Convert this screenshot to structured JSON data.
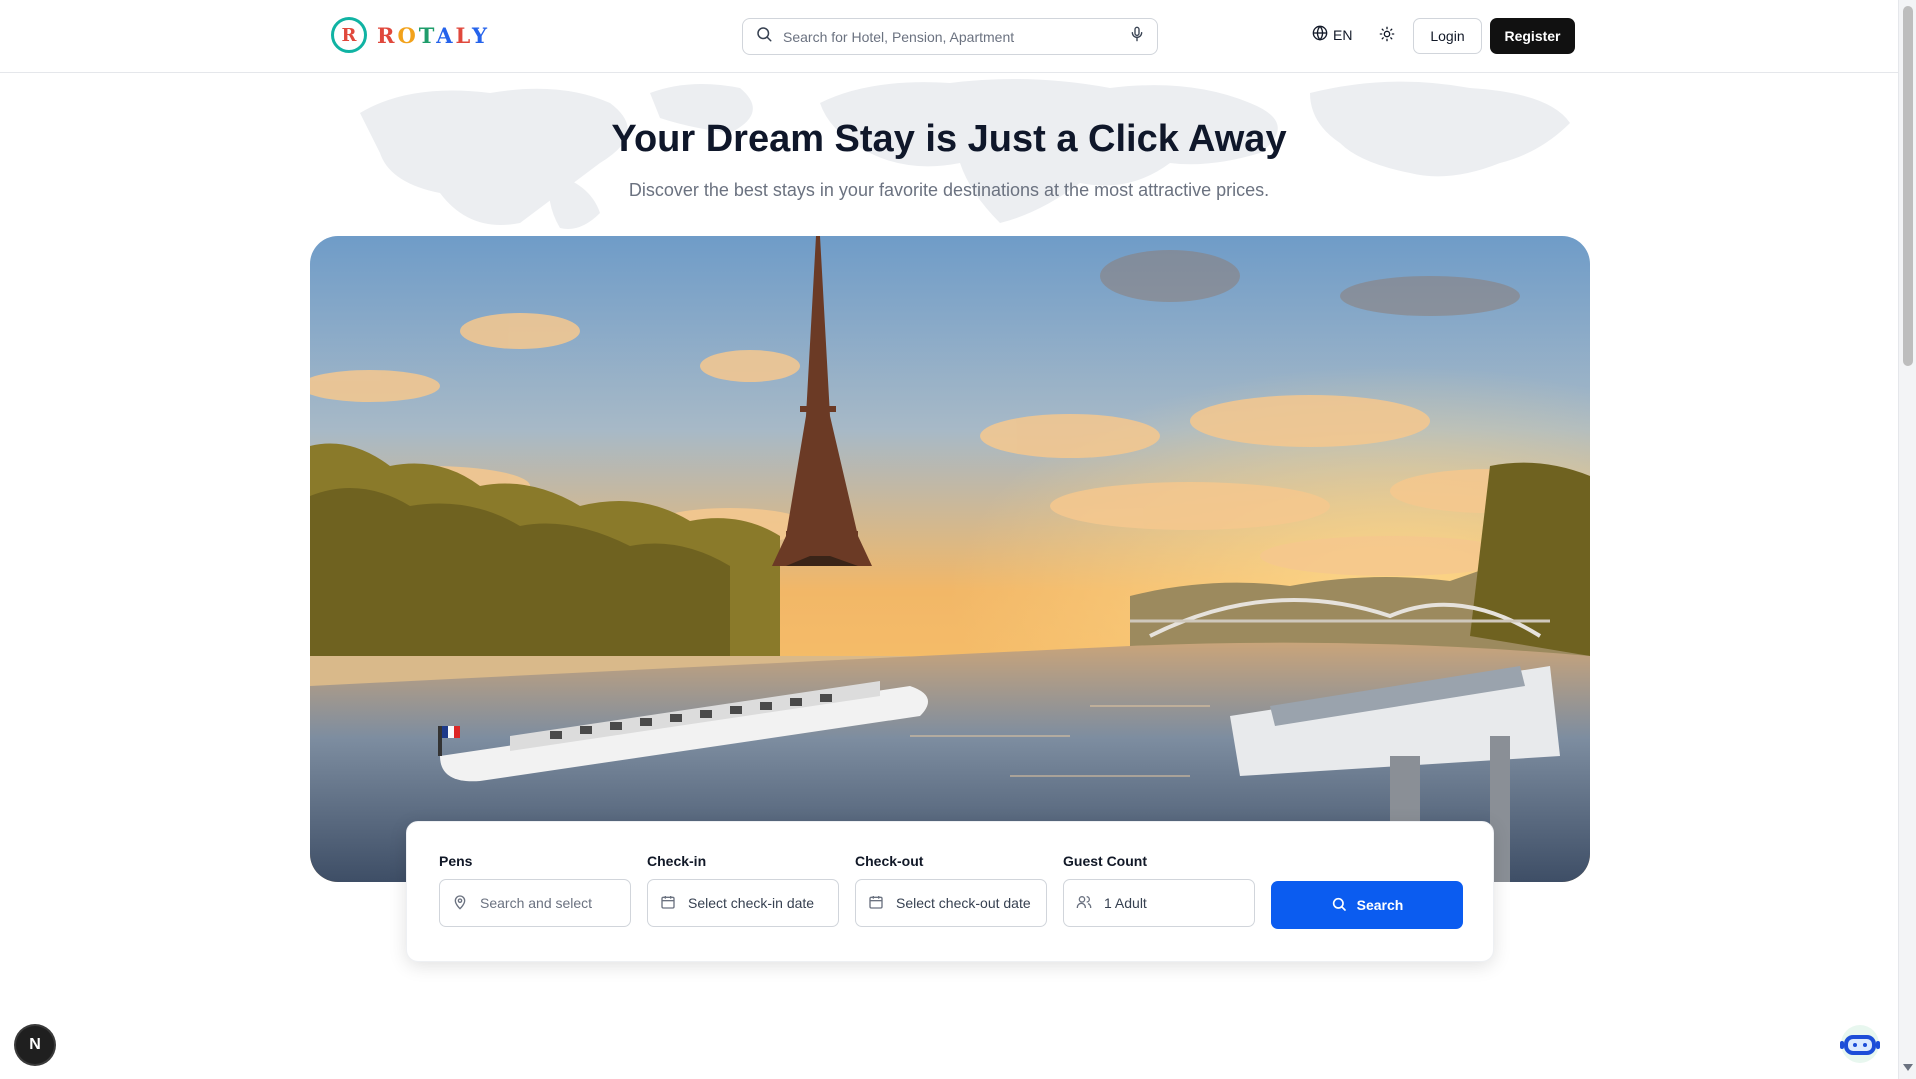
{
  "header": {
    "logo_mark": "R",
    "logo_letters": [
      "R",
      "O",
      "T",
      "A",
      "L",
      "Y"
    ],
    "search_placeholder": "Search for Hotel, Pension, Apartment",
    "language": "EN",
    "login_label": "Login",
    "register_label": "Register"
  },
  "hero": {
    "title": "Your Dream Stay is Just a Click Away",
    "subtitle": "Discover the best stays in your favorite destinations at the most attractive prices."
  },
  "booking": {
    "pens_label": "Pens",
    "pens_placeholder": "Search and select",
    "checkin_label": "Check-in",
    "checkin_value": "Select check-in date",
    "checkout_label": "Check-out",
    "checkout_value": "Select check-out date",
    "guest_label": "Guest Count",
    "guest_value": "1 Adult",
    "search_label": "Search"
  },
  "badge": {
    "letter": "N"
  },
  "icons": {
    "search": "search-icon",
    "microphone": "microphone-icon",
    "globe": "globe-icon",
    "sun": "sun-icon",
    "map_pin": "map-pin-icon",
    "calendar": "calendar-icon",
    "users": "users-icon",
    "chatbot": "chatbot-icon"
  },
  "colors": {
    "primary": "#0b5cf0",
    "register_bg": "#111111",
    "logo_red": "#e0483c",
    "logo_teal": "#10b3a3"
  }
}
